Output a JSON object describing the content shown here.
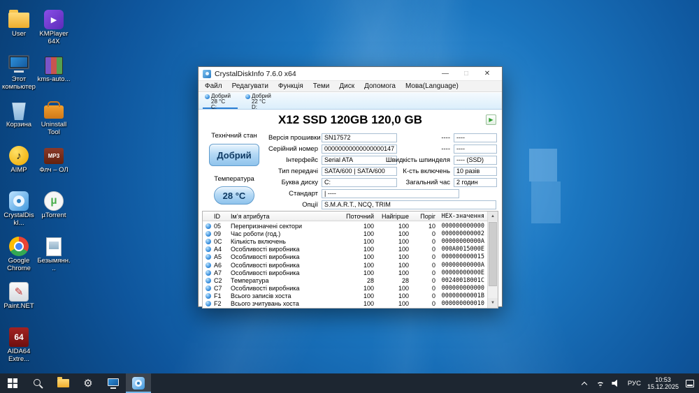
{
  "theme": {
    "accent": "#2a7fd4",
    "health_button": "#8fc3ec",
    "taskbar_bg": "#1d2631",
    "window_bg": "#ffffff",
    "status_good": "#2a84d8"
  },
  "desktop": {
    "icons": [
      {
        "name": "user",
        "label": "User",
        "icon": "folder",
        "glyph": ""
      },
      {
        "name": "this-pc",
        "label": "Этот компьютер",
        "icon": "computer",
        "glyph": ""
      },
      {
        "name": "recycle-bin",
        "label": "Корзина",
        "icon": "recycle",
        "glyph": ""
      },
      {
        "name": "aimp",
        "label": "AIMP",
        "icon": "aimp",
        "glyph": "♪"
      },
      {
        "name": "crystaldiskinfo",
        "label": "CrystalDiskI...",
        "icon": "cdi",
        "glyph": ""
      },
      {
        "name": "google-chrome",
        "label": "Google Chrome",
        "icon": "chrome",
        "glyph": ""
      },
      {
        "name": "paint-net",
        "label": "Paint.NET",
        "icon": "paintnet",
        "glyph": "✎"
      },
      {
        "name": "aida64",
        "label": "AIDA64 Extre...",
        "icon": "aida",
        "glyph": "64"
      },
      {
        "name": "kmplayer",
        "label": "KMPlayer 64X",
        "icon": "kmplayer",
        "glyph": "▶"
      },
      {
        "name": "kms-auto",
        "label": "kms-auto...",
        "icon": "winrar",
        "glyph": ""
      },
      {
        "name": "uninstall-tool",
        "label": "Uninstall Tool",
        "icon": "toolbox",
        "glyph": ""
      },
      {
        "name": "mp3-folder",
        "label": "Флч – ОЛ",
        "icon": "mp3",
        "glyph": "MP3"
      },
      {
        "name": "utorrent",
        "label": "µTorrent",
        "icon": "utorrent",
        "glyph": "µ"
      },
      {
        "name": "untitled",
        "label": "Безымянн...",
        "icon": "file",
        "glyph": ""
      }
    ]
  },
  "window": {
    "title": "CrystalDiskInfo 7.6.0 x64",
    "controls": {
      "minimize": "—",
      "maximize": "□",
      "close": "✕"
    },
    "menu": [
      "Файл",
      "Редагувати",
      "Функція",
      "Теми",
      "Диск",
      "Допомога",
      "Мова(Language)"
    ],
    "drives": [
      {
        "status": "Добрий",
        "temp": "28 °C",
        "letter": "C:",
        "selected": true
      },
      {
        "status": "Добрий",
        "temp": "22 °C",
        "letter": "D:",
        "selected": false
      }
    ],
    "model": "X12 SSD 120GB 120,0 GB",
    "next_button": "▶",
    "health": {
      "label": "Технічний стан",
      "value": "Добрий"
    },
    "temperature": {
      "label": "Температура",
      "value": "28 °C"
    },
    "fields_left": [
      {
        "label": "Версія прошивки",
        "value": "SN17572"
      },
      {
        "label": "Серійний номер",
        "value": "00000000000000000147"
      },
      {
        "label": "Інтерфейс",
        "value": "Serial ATA"
      },
      {
        "label": "Тип передачі",
        "value": "SATA/600 | SATA/600"
      },
      {
        "label": "Буква диску",
        "value": "C:"
      }
    ],
    "fields_wide": [
      {
        "label": "Стандарт",
        "value": "| ----"
      },
      {
        "label": "Опції",
        "value": "S.M.A.R.T., NCQ, TRIM"
      }
    ],
    "fields_right": [
      {
        "label": "----",
        "value": "----"
      },
      {
        "label": "----",
        "value": "----"
      },
      {
        "label": "Швидкість шпинделя",
        "value": "---- (SSD)"
      },
      {
        "label": "К-сть включень",
        "value": "10 разів"
      },
      {
        "label": "Загальний час",
        "value": "2 годин"
      }
    ],
    "smart_table": {
      "headers": [
        "ID",
        "Ім’я атрибута",
        "Поточний",
        "Найгірше",
        "Поріг",
        "HEX-значення"
      ],
      "scroll_up": "▲",
      "scroll_down": "▼",
      "rows": [
        {
          "id": "05",
          "name": "Перепризначені сектори",
          "current": "100",
          "worst": "100",
          "threshold": "10",
          "hex": "000000000000"
        },
        {
          "id": "09",
          "name": "Час роботи (год.)",
          "current": "100",
          "worst": "100",
          "threshold": "0",
          "hex": "000000000002"
        },
        {
          "id": "0C",
          "name": "Кількість включень",
          "current": "100",
          "worst": "100",
          "threshold": "0",
          "hex": "00000000000A"
        },
        {
          "id": "A4",
          "name": "Особливості виробника",
          "current": "100",
          "worst": "100",
          "threshold": "0",
          "hex": "000A0015000E"
        },
        {
          "id": "A5",
          "name": "Особливості виробника",
          "current": "100",
          "worst": "100",
          "threshold": "0",
          "hex": "000000000015"
        },
        {
          "id": "A6",
          "name": "Особливості виробника",
          "current": "100",
          "worst": "100",
          "threshold": "0",
          "hex": "00000000000A"
        },
        {
          "id": "A7",
          "name": "Особливості виробника",
          "current": "100",
          "worst": "100",
          "threshold": "0",
          "hex": "00000000000E"
        },
        {
          "id": "C2",
          "name": "Температура",
          "current": "28",
          "worst": "28",
          "threshold": "0",
          "hex": "00240018001C"
        },
        {
          "id": "C7",
          "name": "Особливості виробника",
          "current": "100",
          "worst": "100",
          "threshold": "0",
          "hex": "000000000000"
        },
        {
          "id": "F1",
          "name": "Всього записів хоста",
          "current": "100",
          "worst": "100",
          "threshold": "0",
          "hex": "00000000001B"
        },
        {
          "id": "F2",
          "name": "Всього зчитувань хоста",
          "current": "100",
          "worst": "100",
          "threshold": "0",
          "hex": "000000000010"
        }
      ]
    }
  },
  "taskbar": {
    "buttons": [
      {
        "name": "start",
        "icon": "start",
        "glyph": "",
        "active": false
      },
      {
        "name": "search",
        "icon": "search",
        "glyph": "",
        "active": false
      },
      {
        "name": "file-explorer",
        "icon": "explorer",
        "glyph": "",
        "active": false
      },
      {
        "name": "settings",
        "icon": "settings",
        "glyph": "⚙",
        "active": false
      },
      {
        "name": "this-pc",
        "icon": "monitor",
        "glyph": "",
        "active": false
      },
      {
        "name": "crystaldiskinfo",
        "icon": "cdi-small",
        "glyph": "",
        "active": true
      }
    ],
    "tray": {
      "lang": "РУС",
      "time": "10:53",
      "date": "15.12.2025"
    }
  }
}
